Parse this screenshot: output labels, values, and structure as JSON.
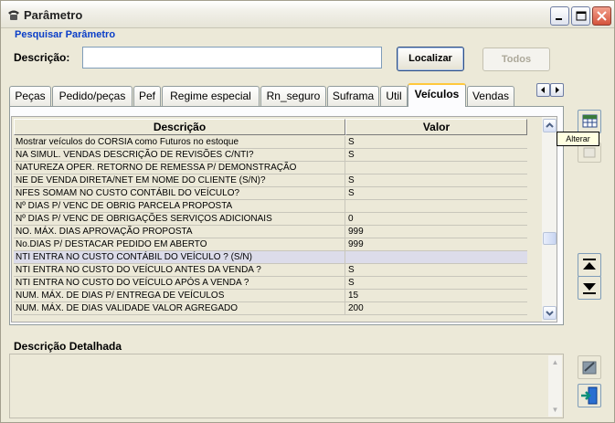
{
  "window": {
    "title": "Parâmetro"
  },
  "search": {
    "header": "Pesquisar Parâmetro",
    "description_label": "Descrição:",
    "description_value": "",
    "find_button": "Localizar",
    "all_button": "Todos"
  },
  "tabs": [
    {
      "label": "Peças"
    },
    {
      "label": "Pedido/peças"
    },
    {
      "label": "Pef"
    },
    {
      "label": "Regime especial"
    },
    {
      "label": "Rn_seguro"
    },
    {
      "label": "Suframa"
    },
    {
      "label": "Util"
    },
    {
      "label": "Veículos",
      "active": true
    },
    {
      "label": "Vendas"
    }
  ],
  "grid": {
    "columns": {
      "description": "Descrição",
      "value": "Valor"
    },
    "rows": [
      {
        "description": "Mostrar veículos do CORSIA como Futuros no estoque",
        "value": "S"
      },
      {
        "description": "NA SIMUL. VENDAS DESCRIÇÃO DE REVISÕES C/NTI?",
        "value": "S"
      },
      {
        "description": "NATUREZA OPER. RETORNO DE REMESSA P/ DEMONSTRAÇÃO",
        "value": ""
      },
      {
        "description": "NE DE VENDA DIRETA/NET EM NOME DO CLIENTE (S/N)?",
        "value": "S"
      },
      {
        "description": "NFES SOMAM NO CUSTO CONTÁBIL DO VEÍCULO?",
        "value": "S"
      },
      {
        "description": "Nº DIAS P/ VENC DE OBRIG PARCELA PROPOSTA",
        "value": ""
      },
      {
        "description": "Nº DIAS P/ VENC DE OBRIGAÇÕES SERVIÇOS ADICIONAIS",
        "value": "0"
      },
      {
        "description": "NO. MÁX. DIAS APROVAÇÃO PROPOSTA",
        "value": "999"
      },
      {
        "description": "No.DIAS P/ DESTACAR PEDIDO EM ABERTO",
        "value": "999"
      },
      {
        "description": "NTI ENTRA NO CUSTO CONTÁBIL DO VEÍCULO ? (S/N)",
        "value": "",
        "selected": true
      },
      {
        "description": "NTI ENTRA NO CUSTO DO VEÍCULO ANTES DA VENDA ?",
        "value": "S"
      },
      {
        "description": "NTI ENTRA NO CUSTO DO VEÍCULO APÓS A VENDA ?",
        "value": "S"
      },
      {
        "description": "NUM. MÁX. DE DIAS P/ ENTREGA DE VEÍCULOS",
        "value": "15"
      },
      {
        "description": "NUM. MÁX. DE DIAS VALIDADE VALOR AGREGADO",
        "value": "200"
      }
    ]
  },
  "tooltip": {
    "text": "Alterar"
  },
  "detail": {
    "label": "Descrição Detalhada",
    "value": ""
  },
  "icons": {
    "edit": "table-edit-icon",
    "move_up": "move-top-icon",
    "move_down": "move-bottom-icon",
    "disabled_action": "disabled-edit-icon",
    "exit": "exit-door-icon"
  }
}
